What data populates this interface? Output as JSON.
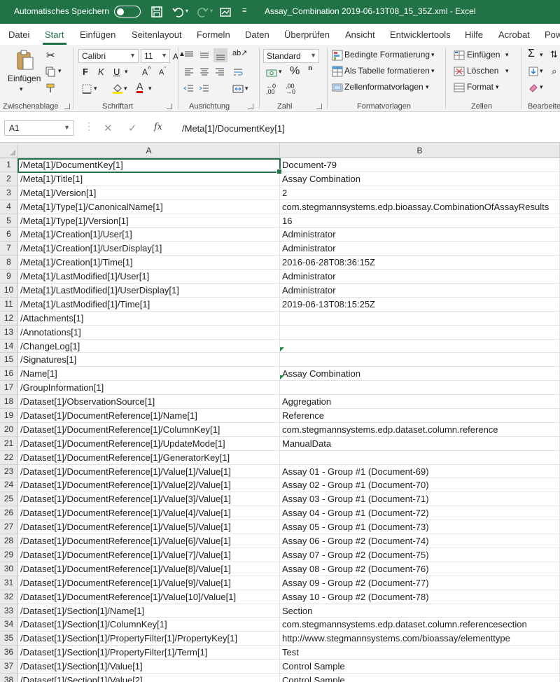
{
  "titlebar": {
    "autosave_label": "Automatisches Speichern",
    "doc_title": "Assay_Combination 2019-06-13T08_15_35Z.xml  -  Excel"
  },
  "tabs": [
    "Datei",
    "Start",
    "Einfügen",
    "Seitenlayout",
    "Formeln",
    "Daten",
    "Überprüfen",
    "Ansicht",
    "Entwicklertools",
    "Hilfe",
    "Acrobat",
    "Pow"
  ],
  "ribbon": {
    "clipboard": {
      "paste_label": "Einfügen",
      "group": "Zwischenablage"
    },
    "font": {
      "name": "Calibri",
      "size": "11",
      "group": "Schriftart",
      "bold": "F",
      "italic": "K",
      "underline": "U"
    },
    "alignment": {
      "group": "Ausrichtung"
    },
    "number": {
      "format": "Standard",
      "group": "Zahl"
    },
    "styles": {
      "conditional": "Bedingte Formatierung",
      "as_table": "Als Tabelle formatieren",
      "cell_styles": "Zellenformatvorlagen",
      "group": "Formatvorlagen"
    },
    "cells": {
      "insert": "Einfügen",
      "delete": "Löschen",
      "format": "Format",
      "group": "Zellen"
    },
    "editing": {
      "group": "Bearbeite"
    }
  },
  "formula_bar": {
    "name_box": "A1",
    "formula": "/Meta[1]/DocumentKey[1]"
  },
  "columns": [
    "A",
    "B"
  ],
  "rows": [
    {
      "n": "1",
      "a": "/Meta[1]/DocumentKey[1]",
      "b": "Document-79"
    },
    {
      "n": "2",
      "a": "/Meta[1]/Title[1]",
      "b": "Assay Combination"
    },
    {
      "n": "3",
      "a": "/Meta[1]/Version[1]",
      "b": "2"
    },
    {
      "n": "4",
      "a": "/Meta[1]/Type[1]/CanonicalName[1]",
      "b": "com.stegmannsystems.edp.bioassay.CombinationOfAssayResults"
    },
    {
      "n": "5",
      "a": "/Meta[1]/Type[1]/Version[1]",
      "b": "16"
    },
    {
      "n": "6",
      "a": "/Meta[1]/Creation[1]/User[1]",
      "b": "Administrator"
    },
    {
      "n": "7",
      "a": "/Meta[1]/Creation[1]/UserDisplay[1]",
      "b": "Administrator"
    },
    {
      "n": "8",
      "a": "/Meta[1]/Creation[1]/Time[1]",
      "b": "2016-06-28T08:36:15Z"
    },
    {
      "n": "9",
      "a": "/Meta[1]/LastModified[1]/User[1]",
      "b": "Administrator"
    },
    {
      "n": "10",
      "a": "/Meta[1]/LastModified[1]/UserDisplay[1]",
      "b": "Administrator"
    },
    {
      "n": "11",
      "a": "/Meta[1]/LastModified[1]/Time[1]",
      "b": "2019-06-13T08:15:25Z"
    },
    {
      "n": "12",
      "a": "/Attachments[1]",
      "b": ""
    },
    {
      "n": "13",
      "a": "/Annotations[1]",
      "b": ""
    },
    {
      "n": "14",
      "a": "/ChangeLog[1]",
      "b": ""
    },
    {
      "n": "15",
      "a": "/Signatures[1]",
      "b": ""
    },
    {
      "n": "16",
      "a": "/Name[1]",
      "b": "Assay Combination"
    },
    {
      "n": "17",
      "a": "/GroupInformation[1]",
      "b": ""
    },
    {
      "n": "18",
      "a": "/Dataset[1]/ObservationSource[1]",
      "b": "Aggregation"
    },
    {
      "n": "19",
      "a": "/Dataset[1]/DocumentReference[1]/Name[1]",
      "b": "Reference"
    },
    {
      "n": "20",
      "a": "/Dataset[1]/DocumentReference[1]/ColumnKey[1]",
      "b": "com.stegmannsystems.edp.dataset.column.reference"
    },
    {
      "n": "21",
      "a": "/Dataset[1]/DocumentReference[1]/UpdateMode[1]",
      "b": "ManualData"
    },
    {
      "n": "22",
      "a": "/Dataset[1]/DocumentReference[1]/GeneratorKey[1]",
      "b": ""
    },
    {
      "n": "23",
      "a": "/Dataset[1]/DocumentReference[1]/Value[1]/Value[1]",
      "b": "Assay 01 - Group #1 (Document-69)"
    },
    {
      "n": "24",
      "a": "/Dataset[1]/DocumentReference[1]/Value[2]/Value[1]",
      "b": "Assay 02 - Group #1 (Document-70)"
    },
    {
      "n": "25",
      "a": "/Dataset[1]/DocumentReference[1]/Value[3]/Value[1]",
      "b": "Assay 03 - Group #1 (Document-71)"
    },
    {
      "n": "26",
      "a": "/Dataset[1]/DocumentReference[1]/Value[4]/Value[1]",
      "b": "Assay 04 - Group #1 (Document-72)"
    },
    {
      "n": "27",
      "a": "/Dataset[1]/DocumentReference[1]/Value[5]/Value[1]",
      "b": "Assay 05 - Group #1 (Document-73)"
    },
    {
      "n": "28",
      "a": "/Dataset[1]/DocumentReference[1]/Value[6]/Value[1]",
      "b": "Assay 06 - Group #2 (Document-74)"
    },
    {
      "n": "29",
      "a": "/Dataset[1]/DocumentReference[1]/Value[7]/Value[1]",
      "b": "Assay 07 - Group #2 (Document-75)"
    },
    {
      "n": "30",
      "a": "/Dataset[1]/DocumentReference[1]/Value[8]/Value[1]",
      "b": "Assay 08 - Group #2 (Document-76)"
    },
    {
      "n": "31",
      "a": "/Dataset[1]/DocumentReference[1]/Value[9]/Value[1]",
      "b": "Assay 09 - Group #2 (Document-77)"
    },
    {
      "n": "32",
      "a": "/Dataset[1]/DocumentReference[1]/Value[10]/Value[1]",
      "b": "Assay 10 - Group #2 (Document-78)"
    },
    {
      "n": "33",
      "a": "/Dataset[1]/Section[1]/Name[1]",
      "b": "Section"
    },
    {
      "n": "34",
      "a": "/Dataset[1]/Section[1]/ColumnKey[1]",
      "b": "com.stegmannsystems.edp.dataset.column.referencesection"
    },
    {
      "n": "35",
      "a": "/Dataset[1]/Section[1]/PropertyFilter[1]/PropertyKey[1]",
      "b": "http://www.stegmannsystems.com/bioassay/elementtype"
    },
    {
      "n": "36",
      "a": "/Dataset[1]/Section[1]/PropertyFilter[1]/Term[1]",
      "b": "Test"
    },
    {
      "n": "37",
      "a": "/Dataset[1]/Section[1]/Value[1]",
      "b": "Control Sample"
    },
    {
      "n": "38",
      "a": "/Dataset[1]/Section[1]/Value[2]",
      "b": "Control Sample"
    }
  ],
  "colors": {
    "accent": "#217346",
    "ribbon_bg": "#f3f3f3",
    "header_bg": "#e9e9e9"
  }
}
